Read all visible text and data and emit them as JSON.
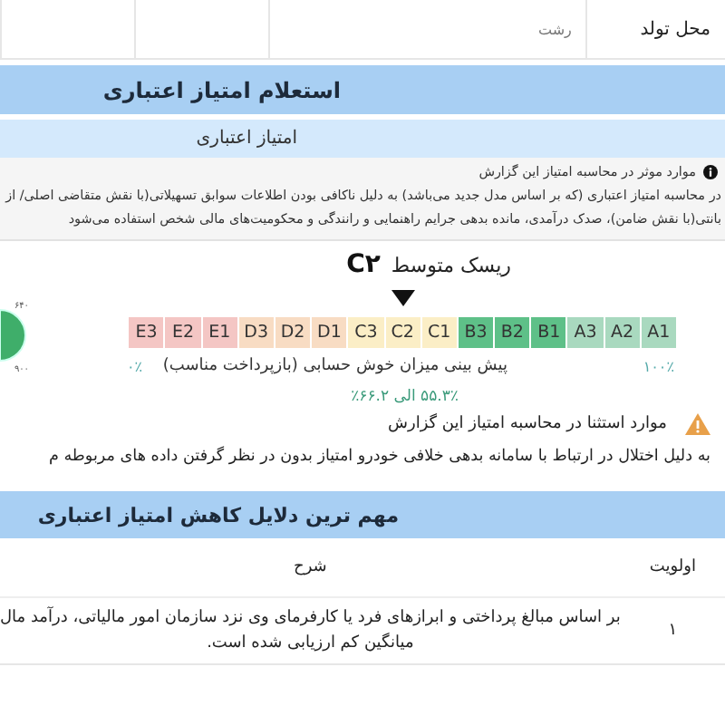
{
  "birth_place": {
    "label": "محل تولد",
    "value": "رشت"
  },
  "section_title": "استعلام امتیاز اعتباری",
  "subsection_title": "امتیاز اعتباری",
  "info": {
    "title": "موارد موثر در محاسبه امتیاز این گزارش",
    "lines": [
      "در محاسبه امتیاز اعتباری (که بر اساس مدل جدید می‌باشد) به دلیل ناکافی بودن اطلاعات سوابق تسهیلاتی(با نقش متقاضی اصلی/ از",
      "بانتی(با نقش ضامن)، صدک درآمدی، مانده بدهی جرایم راهنمایی و رانندگی و محکومیت‌های مالی شخص استفاده می‌شود"
    ]
  },
  "risk": {
    "label": "ریسک متوسط",
    "grade": "C۲"
  },
  "gauge": {
    "labels": [
      "۶۴۰",
      "۹۰۰"
    ]
  },
  "grades": [
    {
      "label": "A1",
      "color": "#a9d9bf",
      "selected": false
    },
    {
      "label": "A2",
      "color": "#a9d9bf",
      "selected": false
    },
    {
      "label": "A3",
      "color": "#a9d9bf",
      "selected": false
    },
    {
      "label": "B1",
      "color": "#5ec088",
      "selected": false
    },
    {
      "label": "B2",
      "color": "#5ec088",
      "selected": false
    },
    {
      "label": "B3",
      "color": "#5ec088",
      "selected": false
    },
    {
      "label": "C1",
      "color": "#fbeec6",
      "selected": false
    },
    {
      "label": "C2",
      "color": "#fbeec6",
      "selected": true
    },
    {
      "label": "C3",
      "color": "#fbeec6",
      "selected": false
    },
    {
      "label": "D1",
      "color": "#f8dcc3",
      "selected": false
    },
    {
      "label": "D2",
      "color": "#f8dcc3",
      "selected": false
    },
    {
      "label": "D3",
      "color": "#f8dcc3",
      "selected": false
    },
    {
      "label": "E1",
      "color": "#f4c6c4",
      "selected": false
    },
    {
      "label": "E2",
      "color": "#f4c6c4",
      "selected": false
    },
    {
      "label": "E3",
      "color": "#f4c6c4",
      "selected": false
    }
  ],
  "scale": {
    "max": "۱۰۰٪",
    "caption": "پیش بینی میزان خوش حسابی (بازپرداخت مناسب)",
    "min": "۰٪",
    "range": "۵۵.۳٪ الی ۶۶.۲٪"
  },
  "warning": {
    "title": "موارد استثنا در محاسبه امتیاز این گزارش",
    "text": "به دلیل اختلال در ارتباط با سامانه بدهی خلافی خودرو امتیاز بدون در نظر گرفتن داده های مربوطه م"
  },
  "reasons": {
    "title": "مهم ترین دلایل کاهش امتیاز اعتباری",
    "columns": [
      "اولویت",
      "شرح"
    ],
    "rows": [
      {
        "priority": "۱",
        "description": [
          "بر اساس مبالغ پرداختی و ابرازهای فرد یا کارفرمای وی نزد سازمان امور مالیاتی، درآمد مال",
          "میانگین کم ارزیابی شده است."
        ]
      }
    ]
  }
}
